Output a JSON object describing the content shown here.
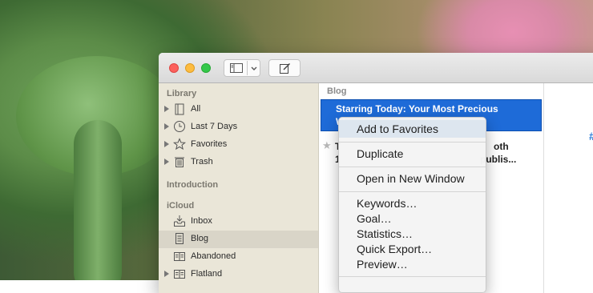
{
  "sidebar": {
    "library_heading": "Library",
    "library_items": [
      {
        "label": "All",
        "icon": "stack-icon"
      },
      {
        "label": "Last 7 Days",
        "icon": "clock-icon"
      },
      {
        "label": "Favorites",
        "icon": "star-icon"
      },
      {
        "label": "Trash",
        "icon": "trash-icon"
      }
    ],
    "introduction_heading": "Introduction",
    "icloud_heading": "iCloud",
    "icloud_items": [
      {
        "label": "Inbox",
        "icon": "inbox-icon"
      },
      {
        "label": "Blog",
        "icon": "document-icon"
      },
      {
        "label": "Abandoned",
        "icon": "group-icon"
      },
      {
        "label": "Flatland",
        "icon": "group-icon"
      }
    ],
    "selected": "Blog"
  },
  "list": {
    "heading": "Blog",
    "rows": [
      {
        "line1": "Starring Today: Your Most Precious",
        "line2": "W"
      },
      {
        "line1": "T",
        "line1_right": "oth",
        "line2": "1",
        "line2_right": "publis..."
      }
    ]
  },
  "editor": {
    "hash": "#"
  },
  "context_menu": {
    "items": [
      "Add to Favorites",
      "Duplicate",
      "Open in New Window",
      "Keywords…",
      "Goal…",
      "Statistics…",
      "Quick Export…",
      "Preview…"
    ],
    "highlighted": "Add to Favorites"
  },
  "colors": {
    "selection": "#1e6bd8",
    "sidebar_bg": "#eae6d8",
    "menu_highlight": "#dde6ef"
  }
}
